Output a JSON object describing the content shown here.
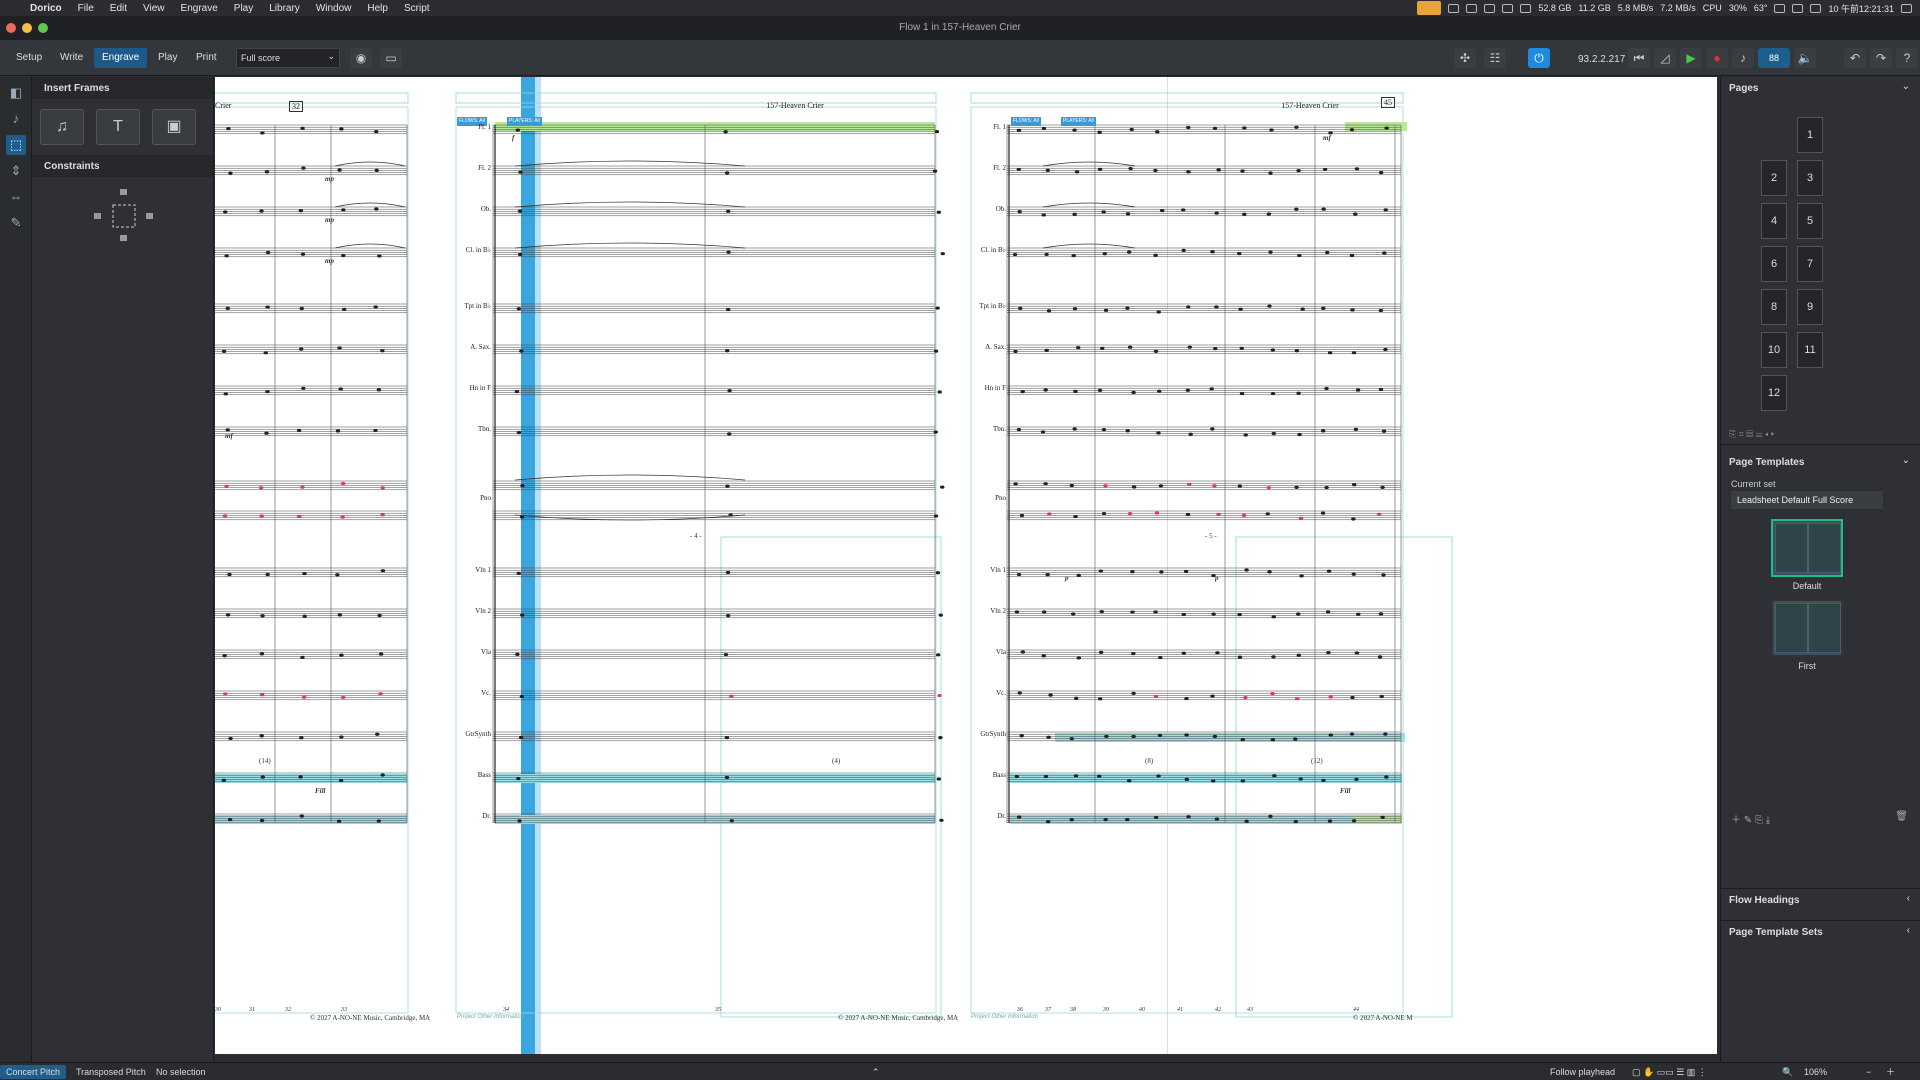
{
  "menubar": {
    "app": "Dorico",
    "items": [
      "File",
      "Edit",
      "View",
      "Engrave",
      "Play",
      "Library",
      "Window",
      "Help",
      "Script"
    ],
    "status": {
      "mem": "52.8 GB",
      "mem2": "11.2 GB",
      "net1": "5.8 MB/s",
      "net2": "7.2 MB/s",
      "cpu_label": "CPU",
      "cpu": "30%",
      "temp": "63°",
      "clock": "10 午前12:21:31"
    }
  },
  "window": {
    "title": "Flow 1 in 157-Heaven Crier"
  },
  "toolbar": {
    "modes": [
      "Setup",
      "Write",
      "Engrave",
      "Play",
      "Print"
    ],
    "active_mode": "Engrave",
    "layout": "Full score",
    "position": "93.2.2.217",
    "tempo": "88"
  },
  "left_panel": {
    "insert_frames": "Insert Frames",
    "constraints": "Constraints"
  },
  "score": {
    "title": "157-Heaven Crier",
    "title_partial": "Crier",
    "instruments": [
      "Fl. 1",
      "Fl. 2",
      "Ob.",
      "Cl. in B♭",
      "Tpt in B♭",
      "A. Sax.",
      "Hn in F",
      "Tbn.",
      "Pno",
      "Vln 1",
      "Vln 2",
      "Vla",
      "Vc.",
      "GtrSynth",
      "Bass",
      "Dr."
    ],
    "copyright": "© 2027 A-NO-NE Music, Cambridge, MA",
    "copyright_partial": "© 2027 A-NO-NE M",
    "project_info": "Project Other Information",
    "bar_numbers": {
      "page_a": "32",
      "page_c": "45"
    },
    "rehearsal": {
      "page_b": "- 4 -",
      "page_c": "- 5 -"
    },
    "flow_labels": [
      "FLOWS: All",
      "PLAYERS: All"
    ],
    "dyn": {
      "f": "f",
      "mf": "mf",
      "mp": "mp",
      "p": "p"
    },
    "fill": "Fill",
    "counts": {
      "c14": "(14)",
      "c4": "(4)",
      "c8": "(8)",
      "c12": "(12)"
    },
    "measure_nums_a": [
      "30",
      "31",
      "32",
      "33"
    ],
    "measure_nums_b": [
      "34",
      "35"
    ],
    "measure_nums_c": [
      "36",
      "37",
      "38",
      "39",
      "40",
      "41",
      "42",
      "43",
      "44"
    ]
  },
  "pages_panel": {
    "title": "Pages",
    "pages": [
      "1",
      "2",
      "3",
      "4",
      "5",
      "6",
      "7",
      "8",
      "9",
      "10",
      "11",
      "12"
    ]
  },
  "page_templates": {
    "title": "Page Templates",
    "current_set_label": "Current set",
    "current_set": "Leadsheet Default Full Score",
    "templates": [
      "Default",
      "First"
    ]
  },
  "flow_headings": {
    "title": "Flow Headings"
  },
  "page_template_sets": {
    "title": "Page Template Sets"
  },
  "status": {
    "concert_pitch": "Concert Pitch",
    "transposed_pitch": "Transposed Pitch",
    "selection": "No selection",
    "follow": "Follow playhead",
    "zoom": "106%"
  }
}
